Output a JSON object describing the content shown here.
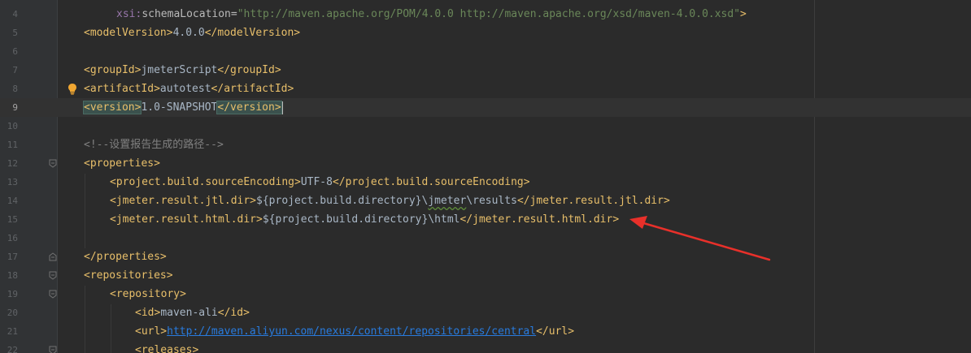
{
  "editor": {
    "lines": [
      {
        "n": "4",
        "tokens": {
          "a1": "xsi:",
          "a2": "schemaLocation",
          "a3": "=",
          "v": "\"http://maven.apache.org/POM/4.0.0 http://maven.apache.org/xsd/maven-4.0.0.xsd\"",
          "t": ">"
        }
      },
      {
        "n": "5",
        "tokens": {
          "o": "<modelVersion>",
          "x": "4.0.0",
          "c": "</modelVersion>"
        }
      },
      {
        "n": "6"
      },
      {
        "n": "7",
        "tokens": {
          "o": "<groupId>",
          "x": "jmeterScript",
          "c": "</groupId>"
        }
      },
      {
        "n": "8",
        "tokens": {
          "o": "<artifactId>",
          "x": "autotest",
          "c": "</artifactId>"
        }
      },
      {
        "n": "9",
        "tokens": {
          "o": "<version>",
          "x": "1.0-SNAPSHOT",
          "c": "</version>"
        }
      },
      {
        "n": "10"
      },
      {
        "n": "11",
        "tokens": {
          "comment": "<!--设置报告生成的路径-->"
        }
      },
      {
        "n": "12",
        "tokens": {
          "o": "<properties>"
        }
      },
      {
        "n": "13",
        "tokens": {
          "o": "<project.build.sourceEncoding>",
          "x": "UTF-8",
          "c": "</project.build.sourceEncoding>"
        }
      },
      {
        "n": "14",
        "tokens": {
          "o": "<jmeter.result.jtl.dir>",
          "x1": "${project.build.directory}\\",
          "x2": "jmeter",
          "x3": "\\results",
          "c": "</jmeter.result.jtl.dir>"
        }
      },
      {
        "n": "15",
        "tokens": {
          "o": "<jmeter.result.html.dir>",
          "x": "${project.build.directory}\\html",
          "c": "</jmeter.result.html.dir>"
        }
      },
      {
        "n": "16"
      },
      {
        "n": "17",
        "tokens": {
          "o": "</properties>"
        }
      },
      {
        "n": "18",
        "tokens": {
          "o": "<repositories>"
        }
      },
      {
        "n": "19",
        "tokens": {
          "o": "<repository>"
        }
      },
      {
        "n": "20",
        "tokens": {
          "o": "<id>",
          "x": "maven-ali",
          "c": "</id>"
        }
      },
      {
        "n": "21",
        "tokens": {
          "o": "<url>",
          "x": "http://maven.aliyun.com/nexus/content/repositories/central",
          "c": "</url>"
        }
      },
      {
        "n": "22",
        "tokens": {
          "o": "<releases>"
        }
      }
    ]
  },
  "colors": {
    "background": "#2b2b2b",
    "gutter": "#313335",
    "tag": "#e8bf6a",
    "attribute_value": "#6a8759",
    "comment": "#808080",
    "text": "#a9b7c6",
    "url": "#287bde",
    "annotation_arrow": "#e8302a"
  },
  "icons": {
    "intention_bulb": "lightbulb-icon",
    "fold_open": "fold-open-icon",
    "fold_end": "fold-end-icon"
  }
}
